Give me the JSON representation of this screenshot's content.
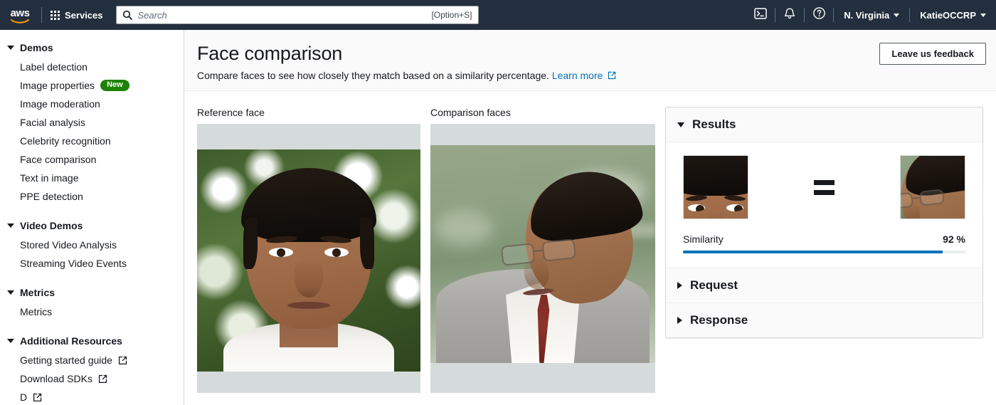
{
  "topnav": {
    "logo_alt": "aws",
    "services_label": "Services",
    "search": {
      "placeholder": "Search",
      "value": "",
      "shortcut": "[Option+S]"
    },
    "cloudshell_icon": "cloudshell-icon",
    "notifications_icon": "bell-icon",
    "help_icon": "help-circle-icon",
    "region": "N. Virginia",
    "account": "KatieOCCRP"
  },
  "sidebar": {
    "sections": [
      {
        "title": "Demos",
        "items": [
          {
            "label": "Label detection"
          },
          {
            "label": "Image properties",
            "badge": "New"
          },
          {
            "label": "Image moderation"
          },
          {
            "label": "Facial analysis"
          },
          {
            "label": "Celebrity recognition"
          },
          {
            "label": "Face comparison"
          },
          {
            "label": "Text in image"
          },
          {
            "label": "PPE detection"
          }
        ]
      },
      {
        "title": "Video Demos",
        "items": [
          {
            "label": "Stored Video Analysis"
          },
          {
            "label": "Streaming Video Events"
          }
        ]
      },
      {
        "title": "Metrics",
        "items": [
          {
            "label": "Metrics"
          }
        ]
      },
      {
        "title": "Additional Resources",
        "items": [
          {
            "label": "Getting started guide",
            "external": true
          },
          {
            "label": "Download SDKs",
            "external": true
          },
          {
            "label": "D",
            "external": true
          }
        ]
      }
    ]
  },
  "header": {
    "title": "Face comparison",
    "description": "Compare faces to see how closely they match based on a similarity percentage.",
    "learn_more": "Learn more",
    "feedback_button": "Leave us feedback"
  },
  "main": {
    "reference_label": "Reference face",
    "comparison_label": "Comparison faces"
  },
  "results": {
    "title": "Results",
    "equals_symbol": "=",
    "similarity_label": "Similarity",
    "similarity_value": "92 %",
    "similarity_percent": 92,
    "bar_color": "#0073bb",
    "sections": [
      {
        "title": "Request"
      },
      {
        "title": "Response"
      }
    ]
  }
}
